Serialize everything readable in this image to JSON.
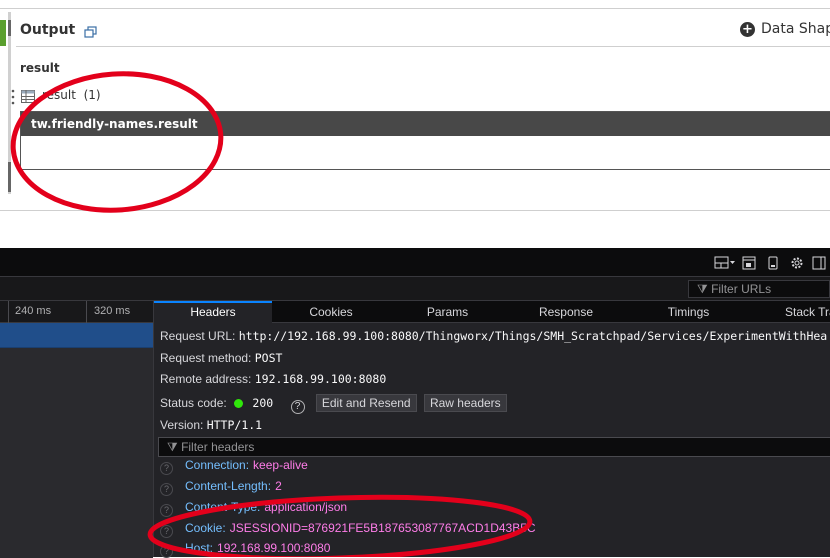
{
  "output": {
    "title": "Output",
    "data_shape_label": "Data Shape",
    "result_label": "result",
    "result_name": "result",
    "result_count": "(1)",
    "table_header": "tw.friendly-names.result"
  },
  "devtools": {
    "filter_urls_placeholder": "Filter URLs",
    "timeline": {
      "ticks": [
        "240 ms",
        "320 ms"
      ]
    },
    "tabs": [
      "Headers",
      "Cookies",
      "Params",
      "Response",
      "Timings",
      "Stack Tra"
    ],
    "request": {
      "url_label": "Request URL:",
      "url_value": "http://192.168.99.100:8080/Thingworx/Things/SMH_Scratchpad/Services/ExperimentWithHea",
      "method_label": "Request method:",
      "method_value": "POST",
      "remote_label": "Remote address:",
      "remote_value": "192.168.99.100:8080",
      "status_label": "Status code:",
      "status_value": "200",
      "edit_resend_label": "Edit and Resend",
      "raw_headers_label": "Raw headers",
      "version_label": "Version:",
      "version_value": "HTTP/1.1"
    },
    "filter_headers_placeholder": "Filter headers",
    "headers": [
      {
        "key": "Connection:",
        "value": "keep-alive"
      },
      {
        "key": "Content-Length:",
        "value": "2"
      },
      {
        "key": "Content-Type:",
        "value": "application/json"
      },
      {
        "key": "Cookie:",
        "value": "JSESSIONID=876921FE5B187653087767ACD1D43B5C"
      },
      {
        "key": "Host:",
        "value": "192.168.99.100:8080"
      }
    ]
  },
  "colors": {
    "annotation_red": "#e3001b",
    "accent_blue": "#0a84ff",
    "status_green": "#30e60b"
  }
}
